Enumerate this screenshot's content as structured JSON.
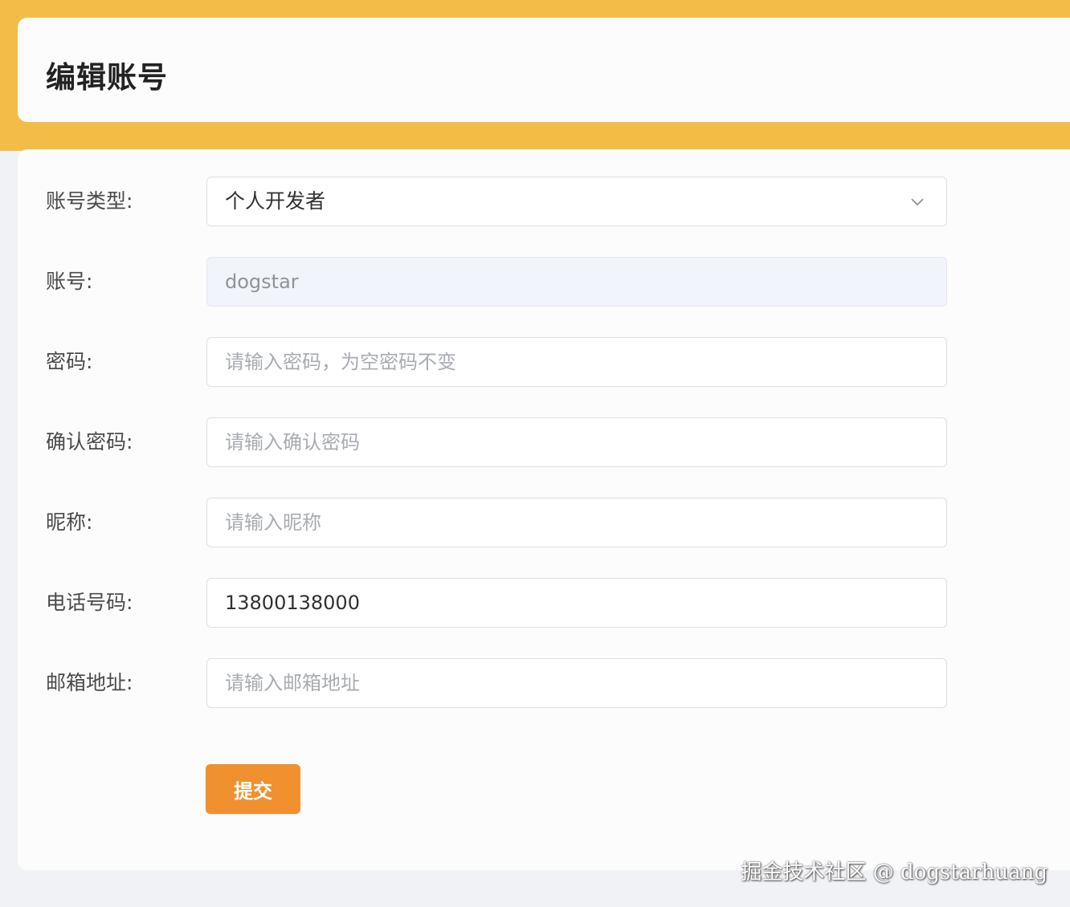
{
  "header": {
    "title": "编辑账号"
  },
  "form": {
    "account_type": {
      "label": "账号类型:",
      "value": "个人开发者"
    },
    "account": {
      "label": "账号:",
      "value": "dogstar"
    },
    "password": {
      "label": "密码:",
      "placeholder": "请输入密码，为空密码不变"
    },
    "confirm_password": {
      "label": "确认密码:",
      "placeholder": "请输入确认密码"
    },
    "nickname": {
      "label": "昵称:",
      "placeholder": "请输入昵称"
    },
    "phone": {
      "label": "电话号码:",
      "value": "13800138000"
    },
    "email": {
      "label": "邮箱地址:",
      "placeholder": "请输入邮箱地址"
    },
    "submit_label": "提交"
  },
  "watermark": "掘金技术社区 @ dogstarhuang",
  "colors": {
    "accent": "#f3bc47",
    "button": "#f0902f"
  },
  "icons": {
    "select_arrow": "chevron-down-icon"
  }
}
